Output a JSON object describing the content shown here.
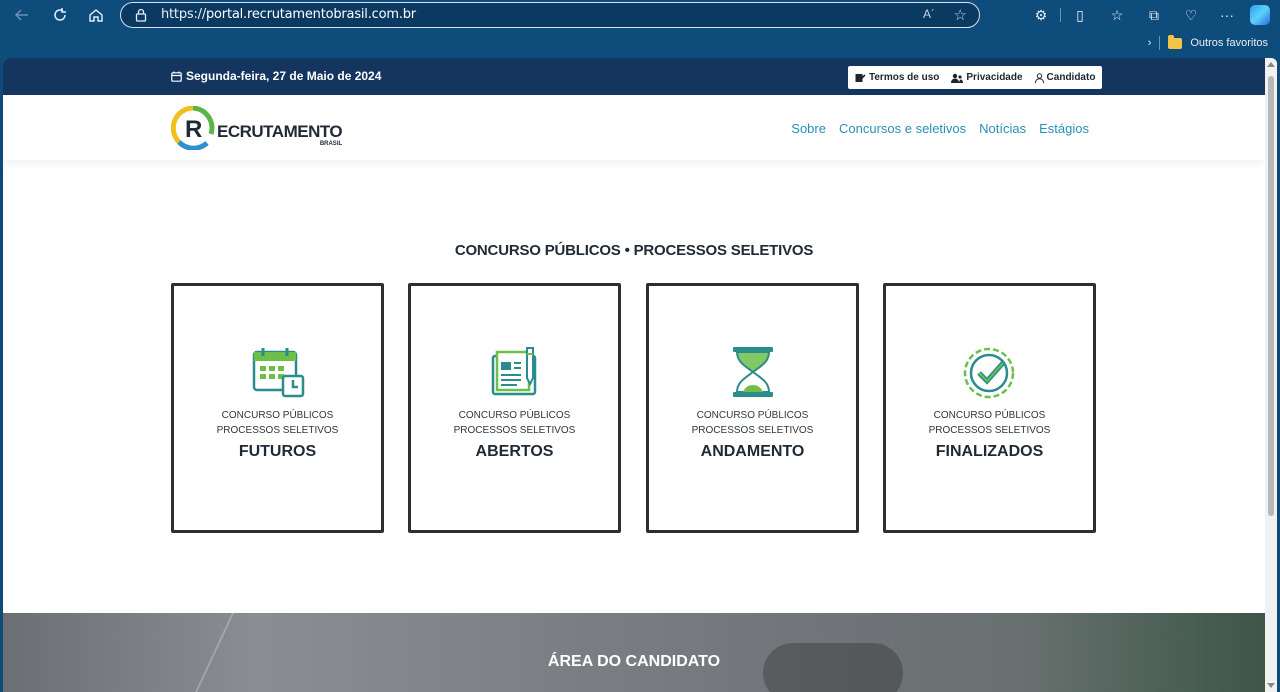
{
  "browser": {
    "url_scheme": "https://",
    "url_host": "portal.recrutamentobrasil.com.br",
    "reader_label": "A´",
    "favorites_folder": "Outros favoritos"
  },
  "topbar": {
    "date": "Segunda-feira, 27 de Maio de 2024",
    "links": [
      {
        "label": "Termos de uso",
        "icon": "document-icon"
      },
      {
        "label": "Privacidade",
        "icon": "users-icon"
      },
      {
        "label": "Candidato",
        "icon": "user-icon"
      }
    ]
  },
  "logo": {
    "letter": "R",
    "word": "ECRUTAMENTO",
    "sub": "BRASIL"
  },
  "menu": [
    "Sobre",
    "Concursos e seletivos",
    "Notícias",
    "Estágios"
  ],
  "section_title": "CONCURSO PÚBLICOS • PROCESSOS SELETIVOS",
  "cards": [
    {
      "line1": "CONCURSO PÚBLICOS",
      "line2": "PROCESSOS SELETIVOS",
      "title": "FUTUROS",
      "icon": "calendar-clock-icon"
    },
    {
      "line1": "CONCURSO PÚBLICOS",
      "line2": "PROCESSOS SELETIVOS",
      "title": "ABERTOS",
      "icon": "document-edit-icon"
    },
    {
      "line1": "CONCURSO PÚBLICOS",
      "line2": "PROCESSOS SELETIVOS",
      "title": "ANDAMENTO",
      "icon": "hourglass-icon"
    },
    {
      "line1": "CONCURSO PÚBLICOS",
      "line2": "PROCESSOS SELETIVOS",
      "title": "FINALIZADOS",
      "icon": "check-badge-icon"
    }
  ],
  "candidate_area": {
    "title": "ÁREA DO CANDIDATO"
  },
  "colors": {
    "topbar": "#13355e",
    "link": "#2a8fb8",
    "icon_green": "#6cc04a",
    "icon_teal": "#2a8c8c"
  }
}
